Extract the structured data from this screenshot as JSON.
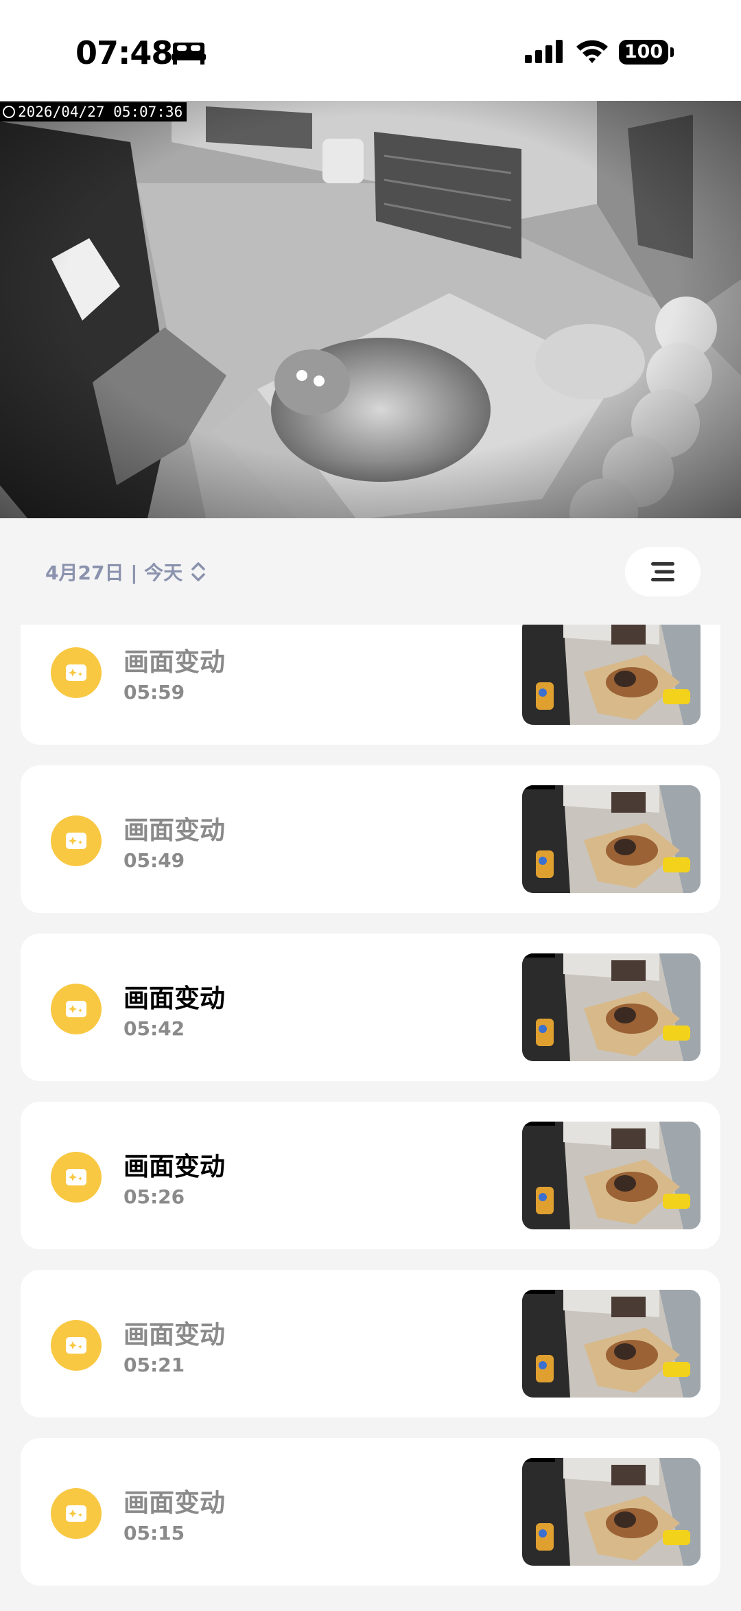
{
  "status_bar": {
    "time": "07:48",
    "focus_icon": "bed-icon",
    "battery": "100"
  },
  "camera": {
    "timestamp": "2026/04/27  05:07:36"
  },
  "date_bar": {
    "date_label": "4月27日 | 今天"
  },
  "events": [
    {
      "title": "画面变动",
      "time": "05:59",
      "read": true
    },
    {
      "title": "画面变动",
      "time": "05:49",
      "read": true
    },
    {
      "title": "画面变动",
      "time": "05:42",
      "read": false
    },
    {
      "title": "画面变动",
      "time": "05:26",
      "read": false
    },
    {
      "title": "画面变动",
      "time": "05:21",
      "read": true
    },
    {
      "title": "画面变动",
      "time": "05:15",
      "read": true
    }
  ],
  "colors": {
    "event_icon": "#f9c843",
    "date_label": "#8a92ad",
    "read_text": "#8a8a8a",
    "unread_text": "#000000",
    "background": "#f4f4f5"
  }
}
